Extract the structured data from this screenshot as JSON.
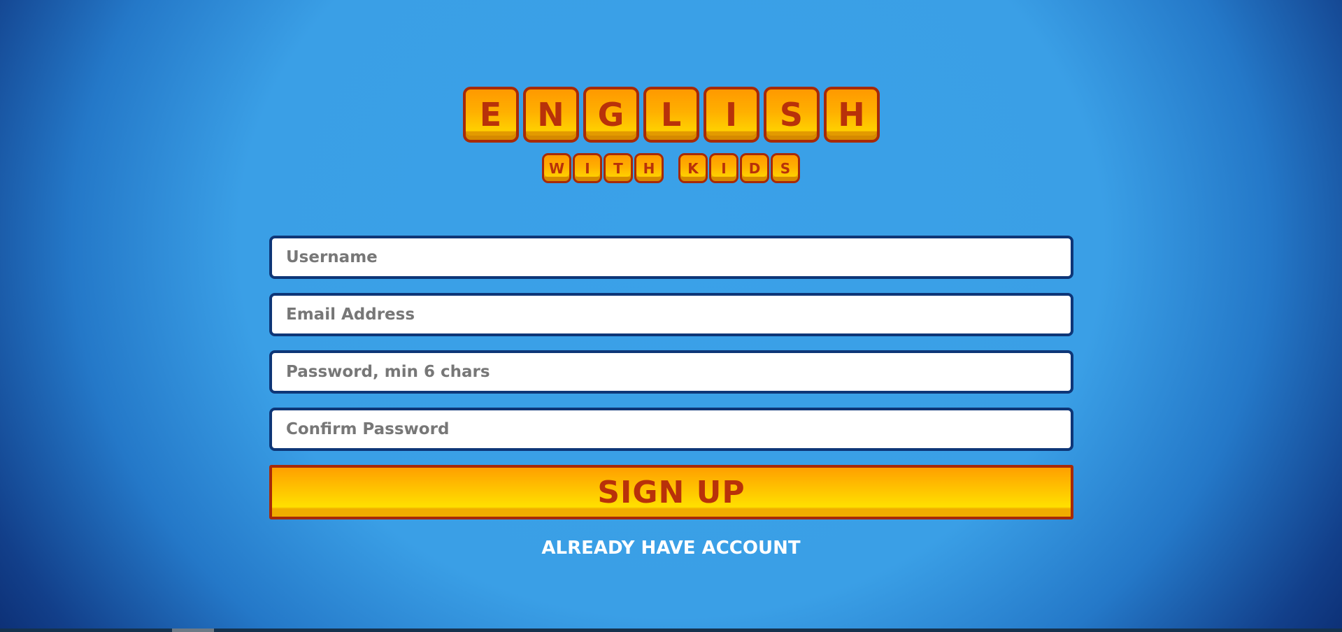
{
  "logo": {
    "title_letters": [
      "E",
      "N",
      "G",
      "L",
      "I",
      "S",
      "H"
    ],
    "subtitle_word1": [
      "W",
      "I",
      "T",
      "H"
    ],
    "subtitle_word2": [
      "K",
      "I",
      "D",
      "S"
    ]
  },
  "form": {
    "username_placeholder": "Username",
    "email_placeholder": "Email Address",
    "password_placeholder": "Password, min 6 chars",
    "confirm_placeholder": "Confirm Password",
    "signup_label": "SIGN UP",
    "already_label": "ALREADY HAVE ACCOUNT"
  },
  "colors": {
    "background": "#3a9fe6",
    "tile_border": "#a72a08",
    "tile_fill": "#ffb000",
    "tile_text": "#b8310a",
    "input_border": "#0e3677"
  }
}
